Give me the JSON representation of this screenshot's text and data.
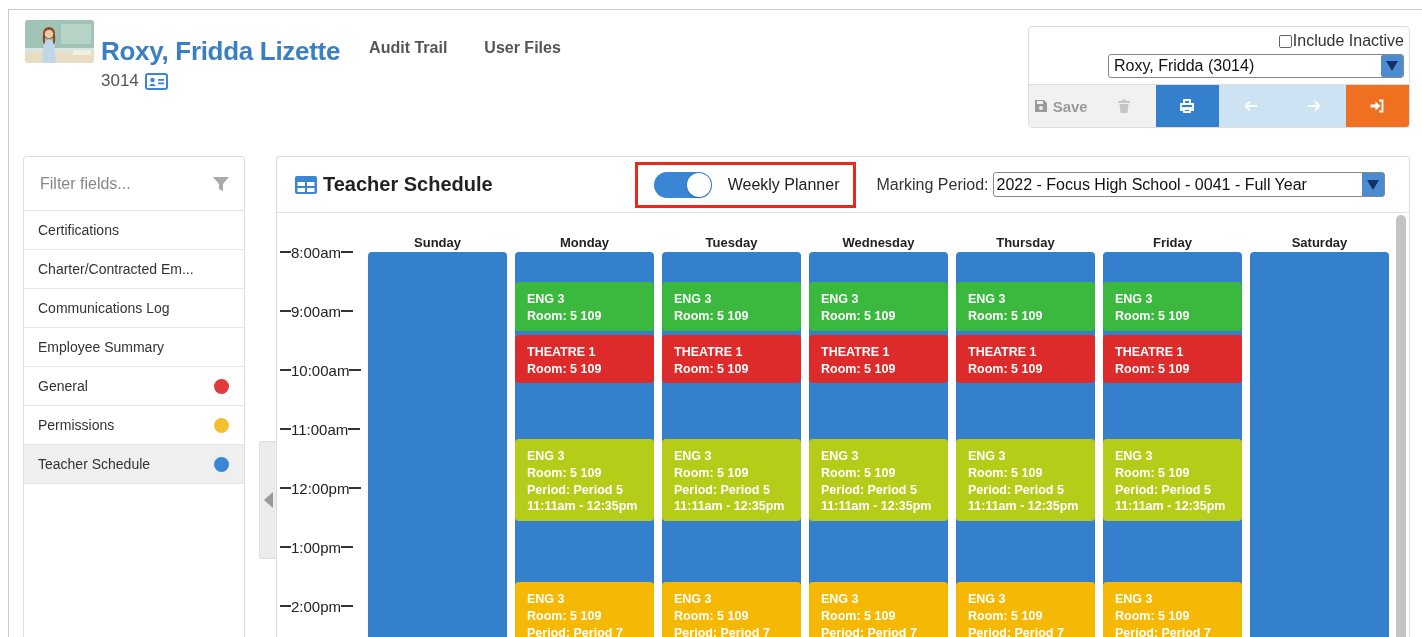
{
  "header": {
    "name": "Roxy, Fridda Lizette",
    "id_number": "3014",
    "links": [
      "Audit Trail",
      "User Files"
    ]
  },
  "user_picker": {
    "include_inactive": {
      "label": "Include Inactive",
      "checked": false
    },
    "selected_user": "Roxy, Fridda (3014)"
  },
  "toolbar": [
    {
      "kind": "save",
      "label": "Save",
      "disabled": true
    },
    {
      "kind": "delete",
      "disabled": true
    },
    {
      "kind": "print",
      "disabled": false
    },
    {
      "kind": "previous",
      "disabled": true
    },
    {
      "kind": "next",
      "disabled": true
    },
    {
      "kind": "login",
      "disabled": false
    }
  ],
  "sidebar": {
    "filter_placeholder": "Filter fields...",
    "items": [
      {
        "label": "Certifications",
        "selected": false
      },
      {
        "label": "Charter/Contracted Em...",
        "selected": false
      },
      {
        "label": "Communications Log",
        "selected": false
      },
      {
        "label": "Employee Summary",
        "selected": false
      },
      {
        "label": "General",
        "selected": false,
        "color": "#e03a3a"
      },
      {
        "label": "Permissions",
        "selected": false,
        "color": "#f4c030"
      },
      {
        "label": "Teacher Schedule",
        "selected": true,
        "color": "#3a85d4"
      }
    ]
  },
  "panel": {
    "title": "Teacher Schedule",
    "weekly_planner": {
      "label": "Weekly Planner",
      "on": true,
      "highlighted": true
    },
    "marking_period": {
      "label": "Marking Period:",
      "value": "2022 - Focus High School - 0041 - Full Year"
    },
    "time_labels": [
      "8:00am",
      "9:00am",
      "10:00am",
      "11:00am",
      "12:00pm",
      "1:00pm",
      "2:00pm"
    ],
    "days": [
      {
        "name": "Sunday"
      },
      {
        "name": "Monday",
        "events": [
          {
            "color": "#3bb83e",
            "lines": [
              "ENG 3",
              "Room: 5 109"
            ]
          },
          {
            "color": "#dd2a2a",
            "lines": [
              "THEATRE 1",
              "Room: 5 109"
            ]
          },
          {
            "color": "#b5cd19",
            "lines": [
              "ENG 3",
              "Room: 5 109",
              "Period: Period 5",
              "11:11am - 12:35pm"
            ]
          },
          {
            "color": "#f5b905",
            "lines": [
              "ENG 3",
              "Room: 5 109",
              "Period: Period 7"
            ]
          }
        ]
      },
      {
        "name": "Tuesday",
        "events": [
          {
            "color": "#3bb83e",
            "lines": [
              "ENG 3",
              "Room: 5 109"
            ]
          },
          {
            "color": "#dd2a2a",
            "lines": [
              "THEATRE 1",
              "Room: 5 109"
            ]
          },
          {
            "color": "#b5cd19",
            "lines": [
              "ENG 3",
              "Room: 5 109",
              "Period: Period 5",
              "11:11am - 12:35pm"
            ]
          },
          {
            "color": "#f5b905",
            "lines": [
              "ENG 3",
              "Room: 5 109",
              "Period: Period 7"
            ]
          }
        ]
      },
      {
        "name": "Wednesday",
        "events": [
          {
            "color": "#3bb83e",
            "lines": [
              "ENG 3",
              "Room: 5 109"
            ]
          },
          {
            "color": "#dd2a2a",
            "lines": [
              "THEATRE 1",
              "Room: 5 109"
            ]
          },
          {
            "color": "#b5cd19",
            "lines": [
              "ENG 3",
              "Room: 5 109",
              "Period: Period 5",
              "11:11am - 12:35pm"
            ]
          },
          {
            "color": "#f5b905",
            "lines": [
              "ENG 3",
              "Room: 5 109",
              "Period: Period 7"
            ]
          }
        ]
      },
      {
        "name": "Thursday",
        "events": [
          {
            "color": "#3bb83e",
            "lines": [
              "ENG 3",
              "Room: 5 109"
            ]
          },
          {
            "color": "#dd2a2a",
            "lines": [
              "THEATRE 1",
              "Room: 5 109"
            ]
          },
          {
            "color": "#b5cd19",
            "lines": [
              "ENG 3",
              "Room: 5 109",
              "Period: Period 5",
              "11:11am - 12:35pm"
            ]
          },
          {
            "color": "#f5b905",
            "lines": [
              "ENG 3",
              "Room: 5 109",
              "Period: Period 7"
            ]
          }
        ]
      },
      {
        "name": "Friday",
        "events": [
          {
            "color": "#3bb83e",
            "lines": [
              "ENG 3",
              "Room: 5 109"
            ]
          },
          {
            "color": "#dd2a2a",
            "lines": [
              "THEATRE 1",
              "Room: 5 109"
            ]
          },
          {
            "color": "#b5cd19",
            "lines": [
              "ENG 3",
              "Room: 5 109",
              "Period: Period 5",
              "11:11am - 12:35pm"
            ]
          },
          {
            "color": "#f5b905",
            "lines": [
              "ENG 3",
              "Room: 5 109",
              "Period: Period 7"
            ]
          }
        ]
      },
      {
        "name": "Saturday"
      }
    ]
  }
}
